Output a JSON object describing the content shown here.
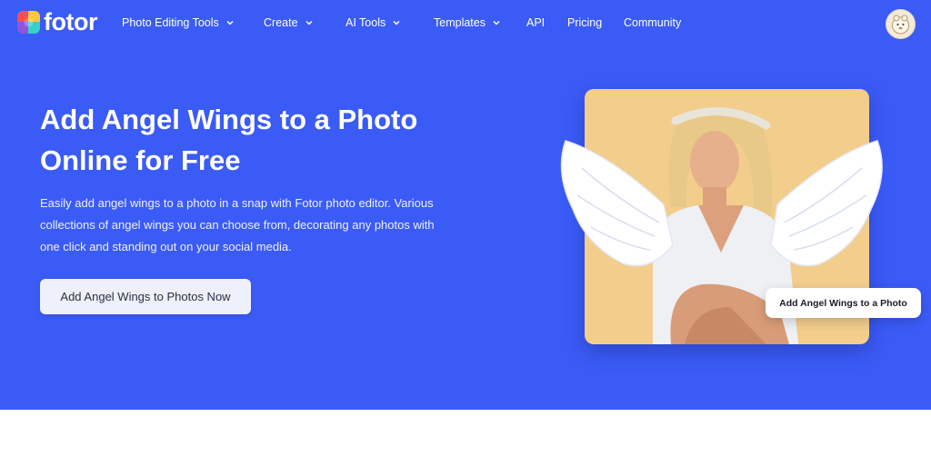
{
  "brand": {
    "name": "fotor"
  },
  "nav": {
    "items": [
      {
        "label": "Photo Editing Tools",
        "has_dropdown": true
      },
      {
        "label": "Create",
        "has_dropdown": true
      },
      {
        "label": "AI Tools",
        "has_dropdown": true
      },
      {
        "label": "Templates",
        "has_dropdown": true
      },
      {
        "label": "API",
        "has_dropdown": false
      },
      {
        "label": "Pricing",
        "has_dropdown": false
      },
      {
        "label": "Community",
        "has_dropdown": false
      }
    ]
  },
  "hero": {
    "title": "Add Angel Wings to a Photo Online for Free",
    "description": "Easily add angel wings to a photo in a snap with Fotor photo editor. Various collections of angel wings you can choose from, decorating any photos with one click and standing out on your social media.",
    "cta_label": "Add Angel Wings to Photos Now",
    "image_label": "Add Angel Wings to a Photo"
  },
  "colors": {
    "hero_bg": "#3b5bf6",
    "card_bg": "#f3cd8c",
    "cta_bg": "#eef1fb"
  },
  "icons": {
    "logo": "fotor-logo-icon",
    "dropdown": "chevron-down-icon",
    "avatar": "user-avatar"
  }
}
